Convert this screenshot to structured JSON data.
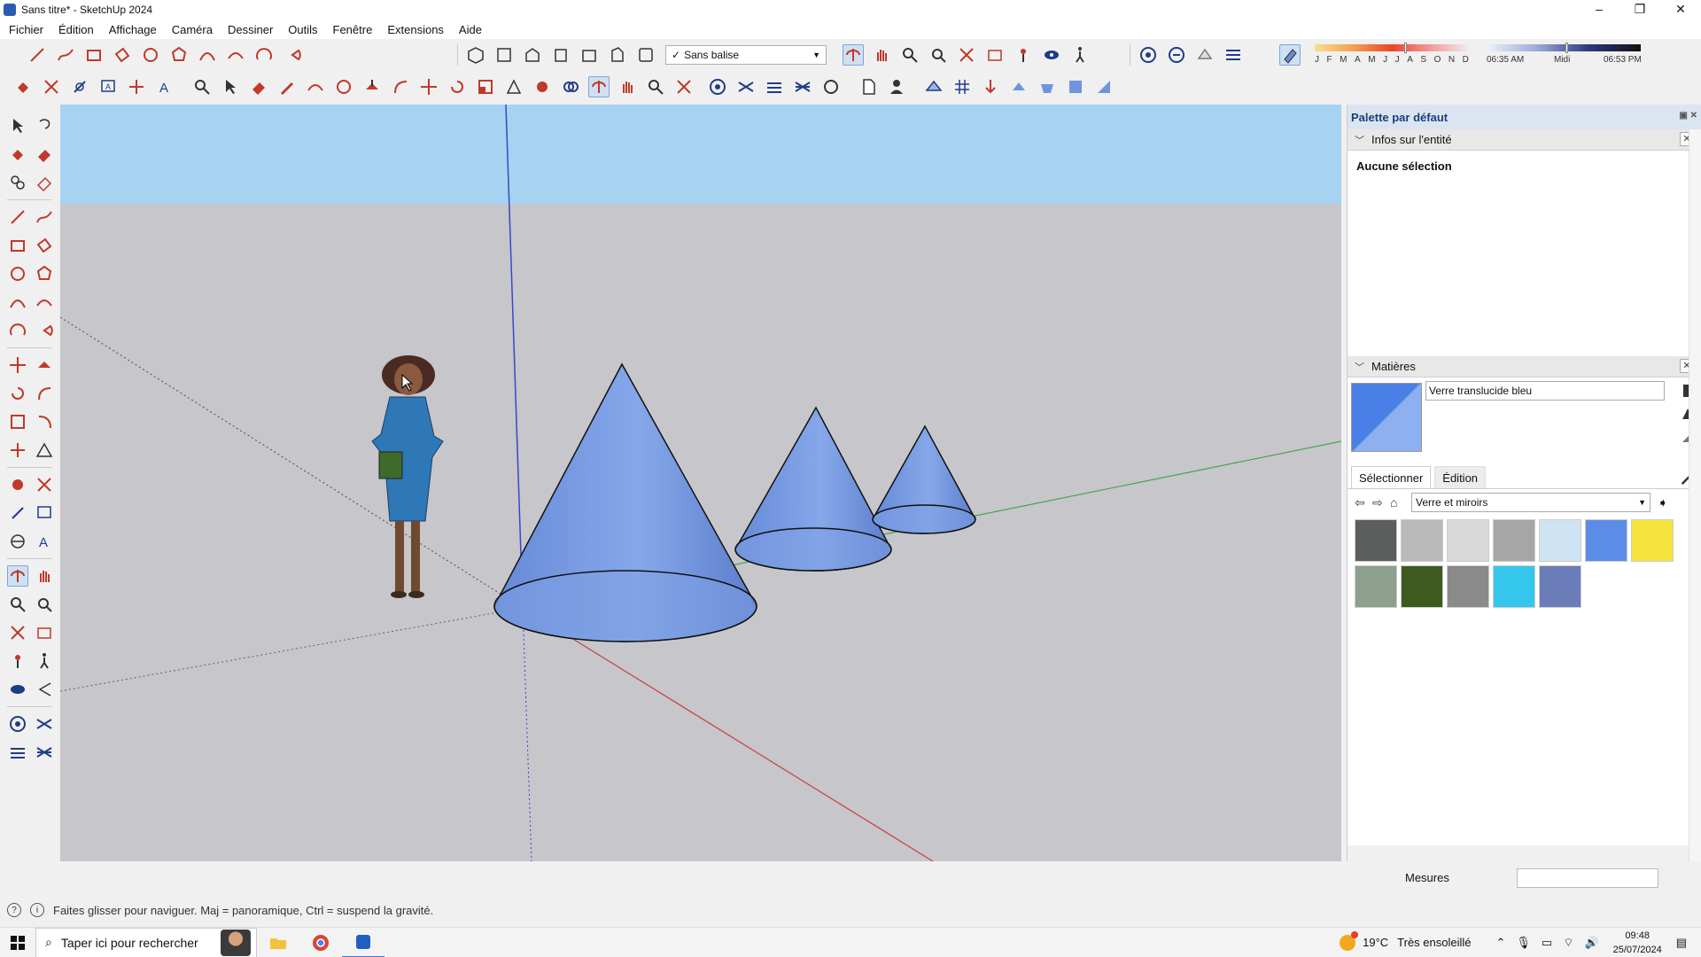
{
  "window": {
    "title": "Sans titre* - SketchUp 2024",
    "minimize": "–",
    "maximize": "❐",
    "close": "✕"
  },
  "menu": [
    "Fichier",
    "Édition",
    "Affichage",
    "Caméra",
    "Dessiner",
    "Outils",
    "Fenêtre",
    "Extensions",
    "Aide"
  ],
  "toolbar": {
    "tag_select_value": "Sans balise",
    "check_mark": "✓",
    "months": [
      "J",
      "F",
      "M",
      "A",
      "M",
      "J",
      "J",
      "A",
      "S",
      "O",
      "N",
      "D"
    ],
    "months_level": 0.58,
    "time_start": "06:35 AM",
    "time_mid": "Midi",
    "time_end": "06:53 PM",
    "time_level": 0.51
  },
  "tray": {
    "title": "Palette par défaut",
    "entity_panel": {
      "title": "Infos sur l'entité",
      "body": "Aucune sélection"
    },
    "materials_panel": {
      "title": "Matières",
      "material_name": "Verre translucide bleu",
      "tabs": [
        "Sélectionner",
        "Édition"
      ],
      "library": "Verre et miroirs",
      "swatch_colors": [
        "#5c5e5e",
        "#b9b9b9",
        "#d9d9d9",
        "#a6a6a6",
        "#cfe4f2",
        "#5b8de8",
        "#f4e33b",
        "#8da08f",
        "#3e5a1f",
        "#8a8a8a",
        "#35c6ee",
        "#6a7db8"
      ]
    }
  },
  "measurements_label": "Mesures",
  "status_text": "Faites glisser pour naviguer. Maj = panoramique, Ctrl = suspend la gravité.",
  "taskbar": {
    "search_placeholder": "Taper ici pour rechercher",
    "temperature": "19°C",
    "weather": "Très ensoleillé",
    "time": "09:48",
    "date": "25/07/2024"
  },
  "colors": {
    "sky": "#a7d3f3",
    "ground": "#c6c6cb",
    "cone": "#6f95e0",
    "axis_red": "#c84040",
    "axis_green": "#46a646",
    "axis_blue": "#3a46c8"
  }
}
